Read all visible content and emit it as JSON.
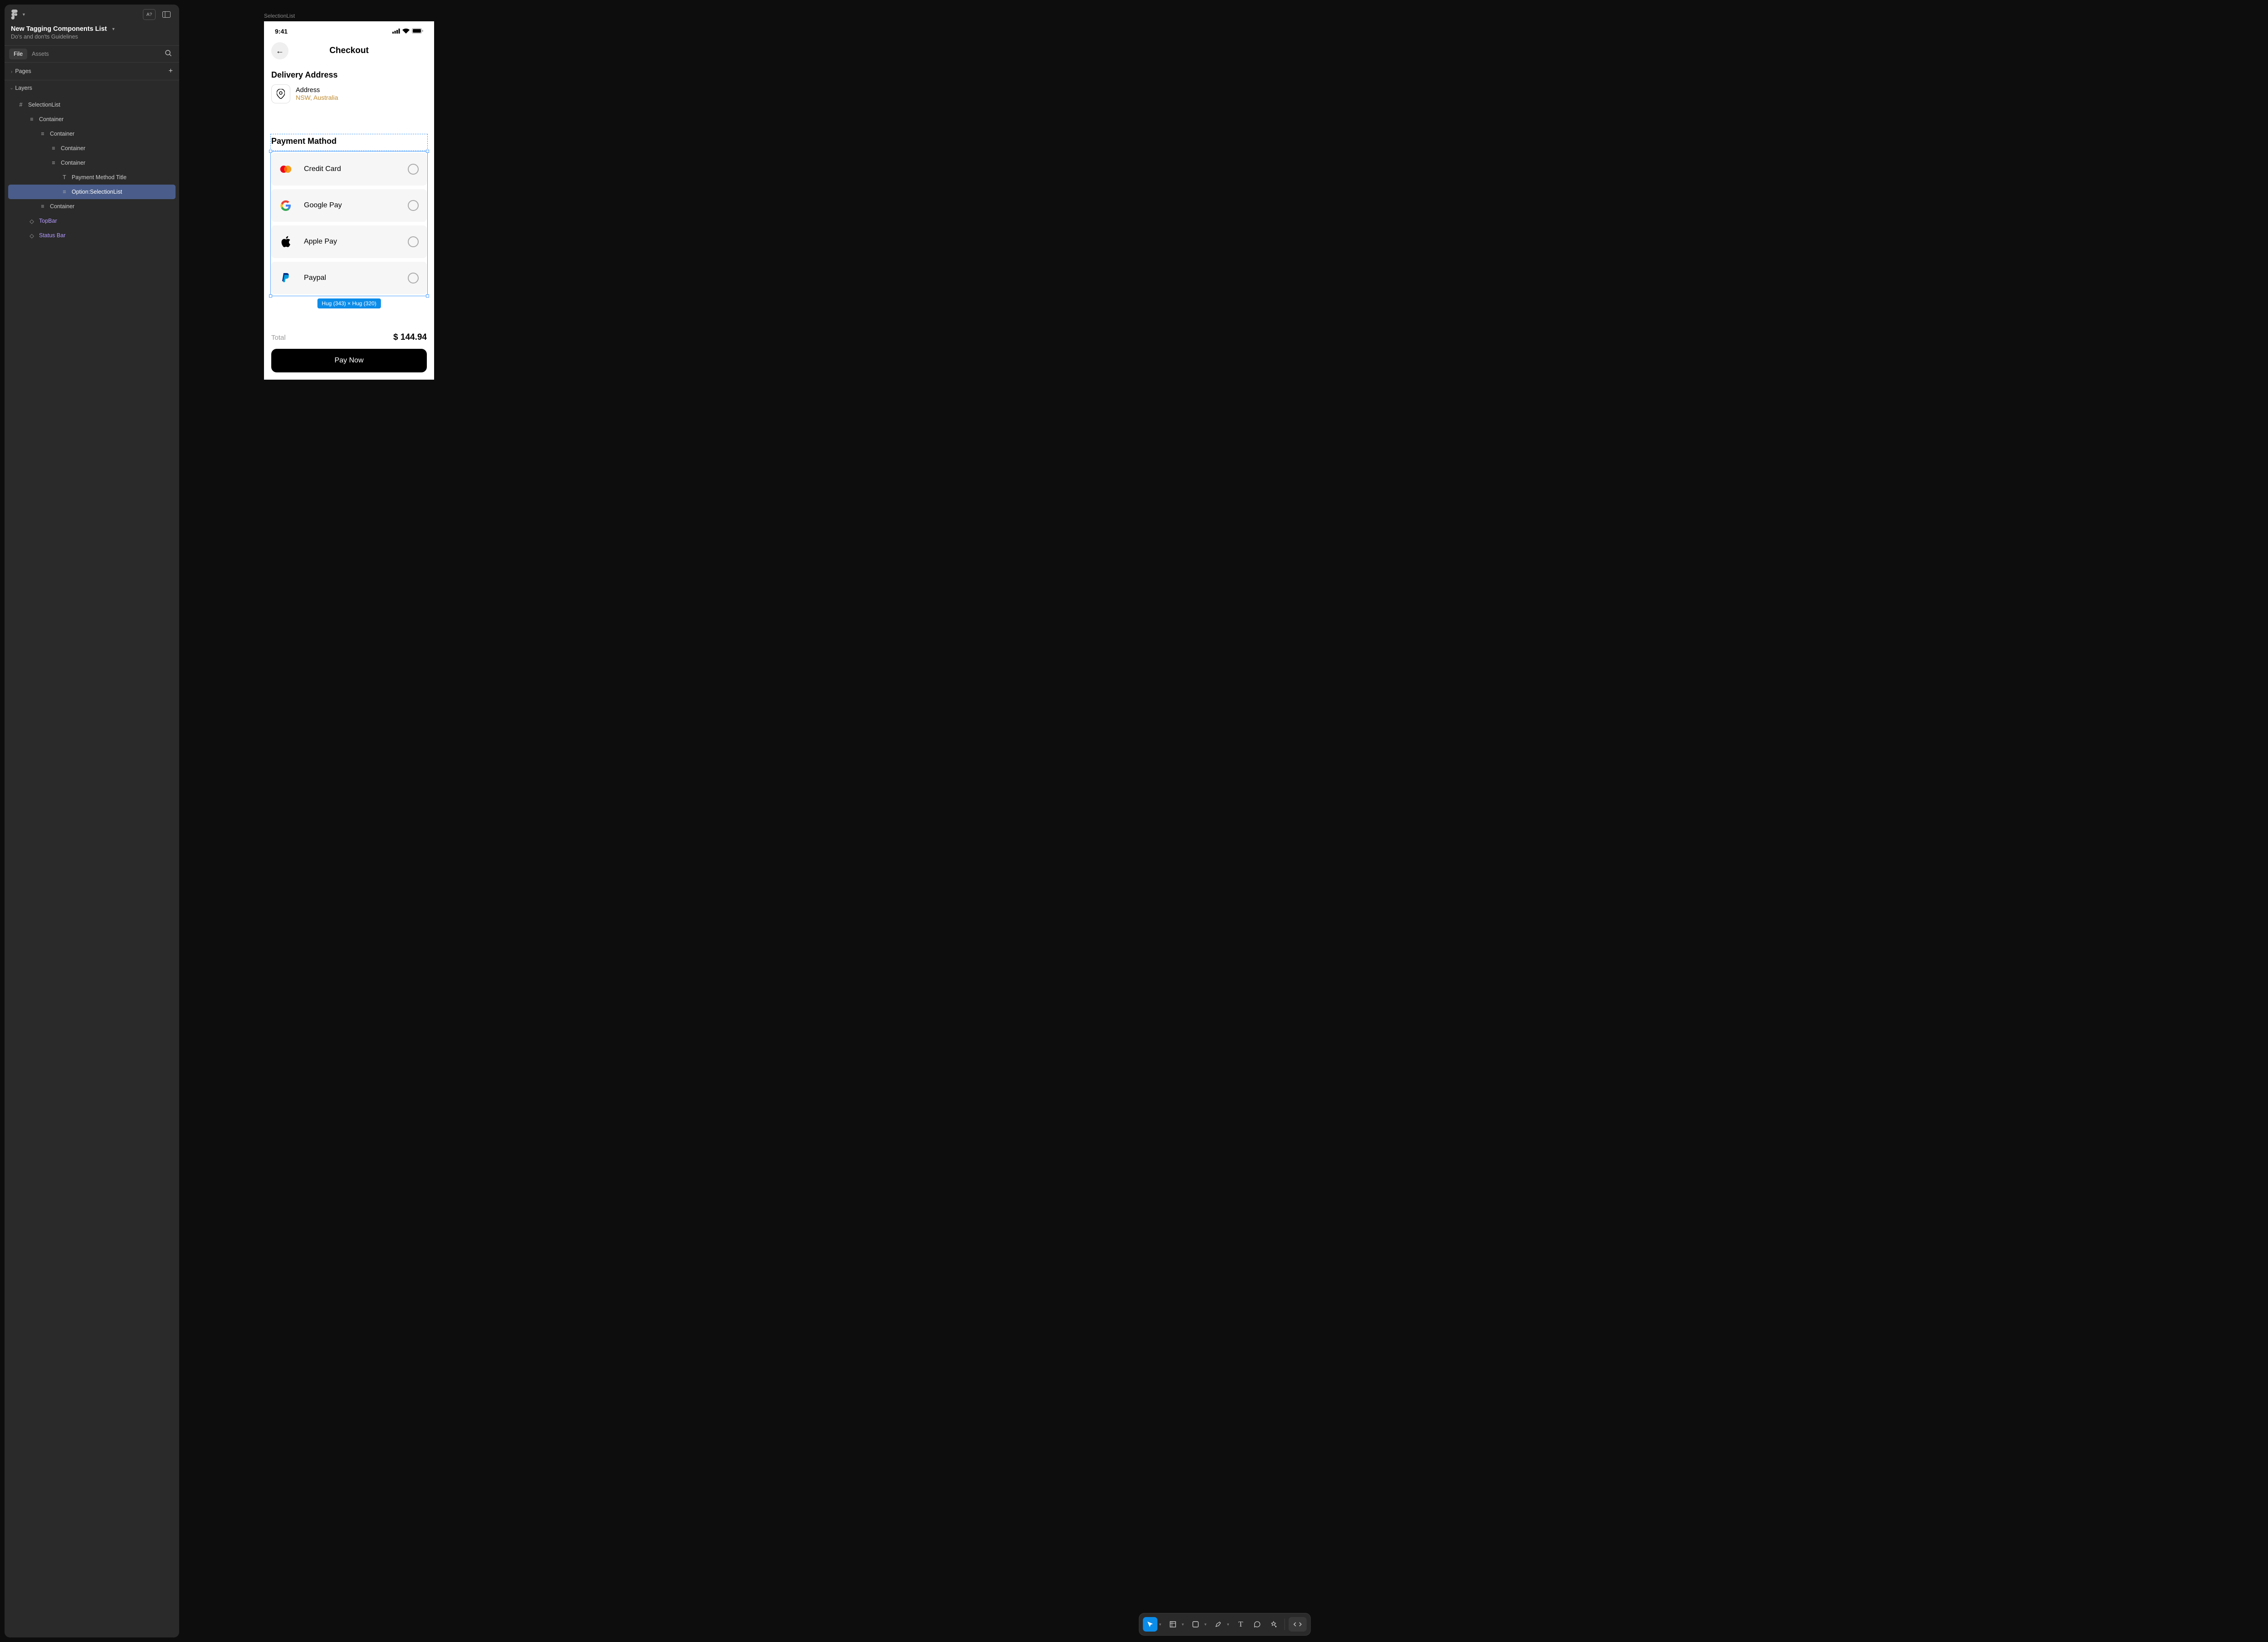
{
  "panel": {
    "file_title": "New Tagging Components List",
    "file_subtitle": "Do's and don'ts Guidelines",
    "tabs": {
      "file": "File",
      "assets": "Assets"
    },
    "pages_label": "Pages",
    "layers_label": "Layers",
    "layers": {
      "l1": "SelectionList",
      "l2": "Container",
      "l3": "Container",
      "l4": "Container",
      "l5": "Container",
      "l6": "Payment Method Title",
      "l7": "Option:SelectionList",
      "l8": "Container",
      "l9": "TopBar",
      "l10": "Status Bar"
    }
  },
  "canvas": {
    "frame_label": "SelectionList",
    "selection_badge": "Hug (343) × Hug (320)"
  },
  "phone": {
    "status_time": "9:41",
    "topbar_title": "Checkout",
    "delivery_title": "Delivery Address",
    "address_label": "Address",
    "address_value": "NSW, Australia",
    "payment_title": "Payment Mathod",
    "methods": {
      "m1": "Credit Card",
      "m2": "Google Pay",
      "m3": "Apple Pay",
      "m4": "Paypal"
    },
    "total_label": "Total",
    "total_value": "$ 144.94",
    "pay_button": "Pay Now"
  }
}
